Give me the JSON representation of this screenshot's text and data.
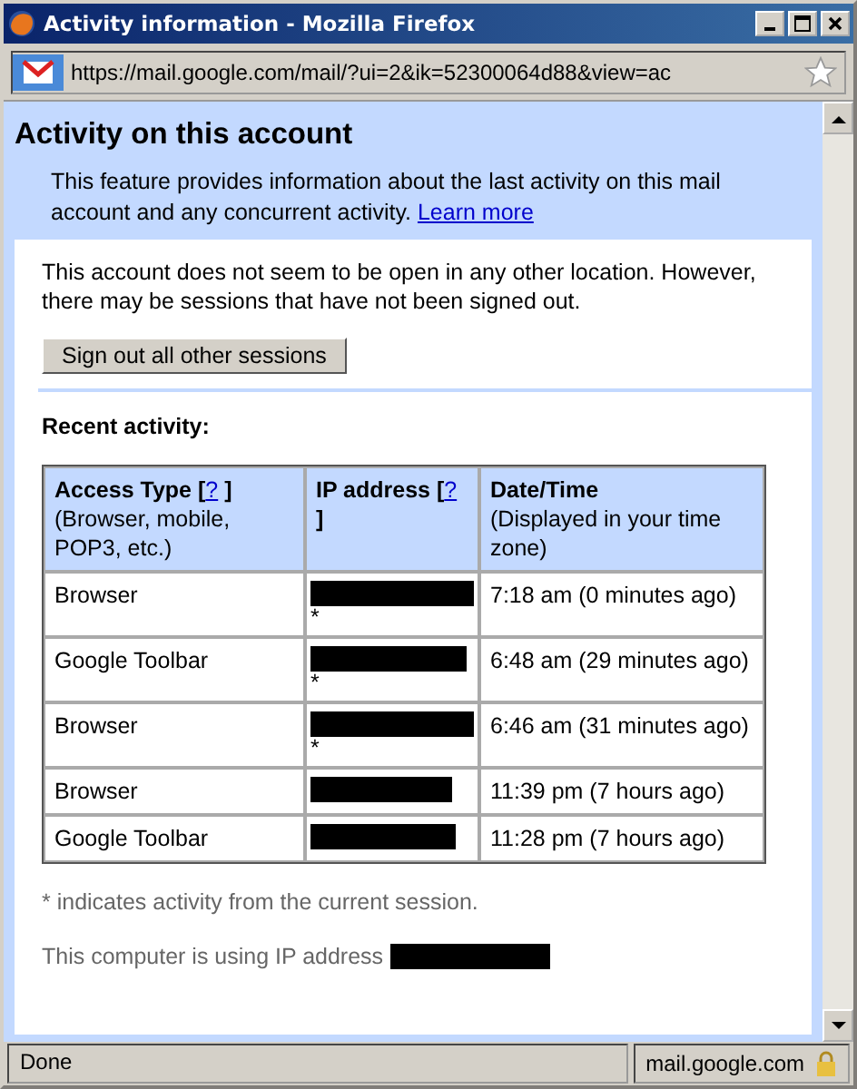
{
  "window": {
    "title": "Activity information - Mozilla Firefox"
  },
  "address_bar": {
    "url": "https://mail.google.com/mail/?ui=2&ik=52300064d88&view=ac"
  },
  "header": {
    "title": "Activity on this account",
    "description": "This feature provides information about the last activity on this mail account and any concurrent activity.",
    "link": "Learn more"
  },
  "notice": "This account does not seem to be open in any other location. However, there may be sessions that have not been signed out.",
  "sign_out_button": "Sign out all other sessions",
  "recent_activity": {
    "heading": "Recent activity:",
    "columns": [
      {
        "label": "Access Type [",
        "help": "?",
        "close": "]",
        "note": "(Browser, mobile, POP3, etc.)"
      },
      {
        "label": "IP address [",
        "help": "?",
        "close": "]"
      },
      {
        "label": "Date/Time",
        "note": "(Displayed in your time zone)"
      }
    ],
    "rows": [
      {
        "access_type": "Browser",
        "ip_marker": "*",
        "date_time": "7:18 am (0 minutes ago)"
      },
      {
        "access_type": "Google Toolbar",
        "ip_marker": "*",
        "date_time": "6:48 am (29 minutes ago)"
      },
      {
        "access_type": "Browser",
        "ip_marker": "*",
        "date_time": "6:46 am (31 minutes ago)"
      },
      {
        "access_type": "Browser",
        "date_time": "11:39 pm (7 hours ago)"
      },
      {
        "access_type": "Google Toolbar",
        "date_time": "11:28 pm (7 hours ago)"
      }
    ]
  },
  "footnote": "* indicates activity from the current session.",
  "ip_line": "This computer is using IP address",
  "status_bar": {
    "status": "Done",
    "domain": "mail.google.com"
  }
}
